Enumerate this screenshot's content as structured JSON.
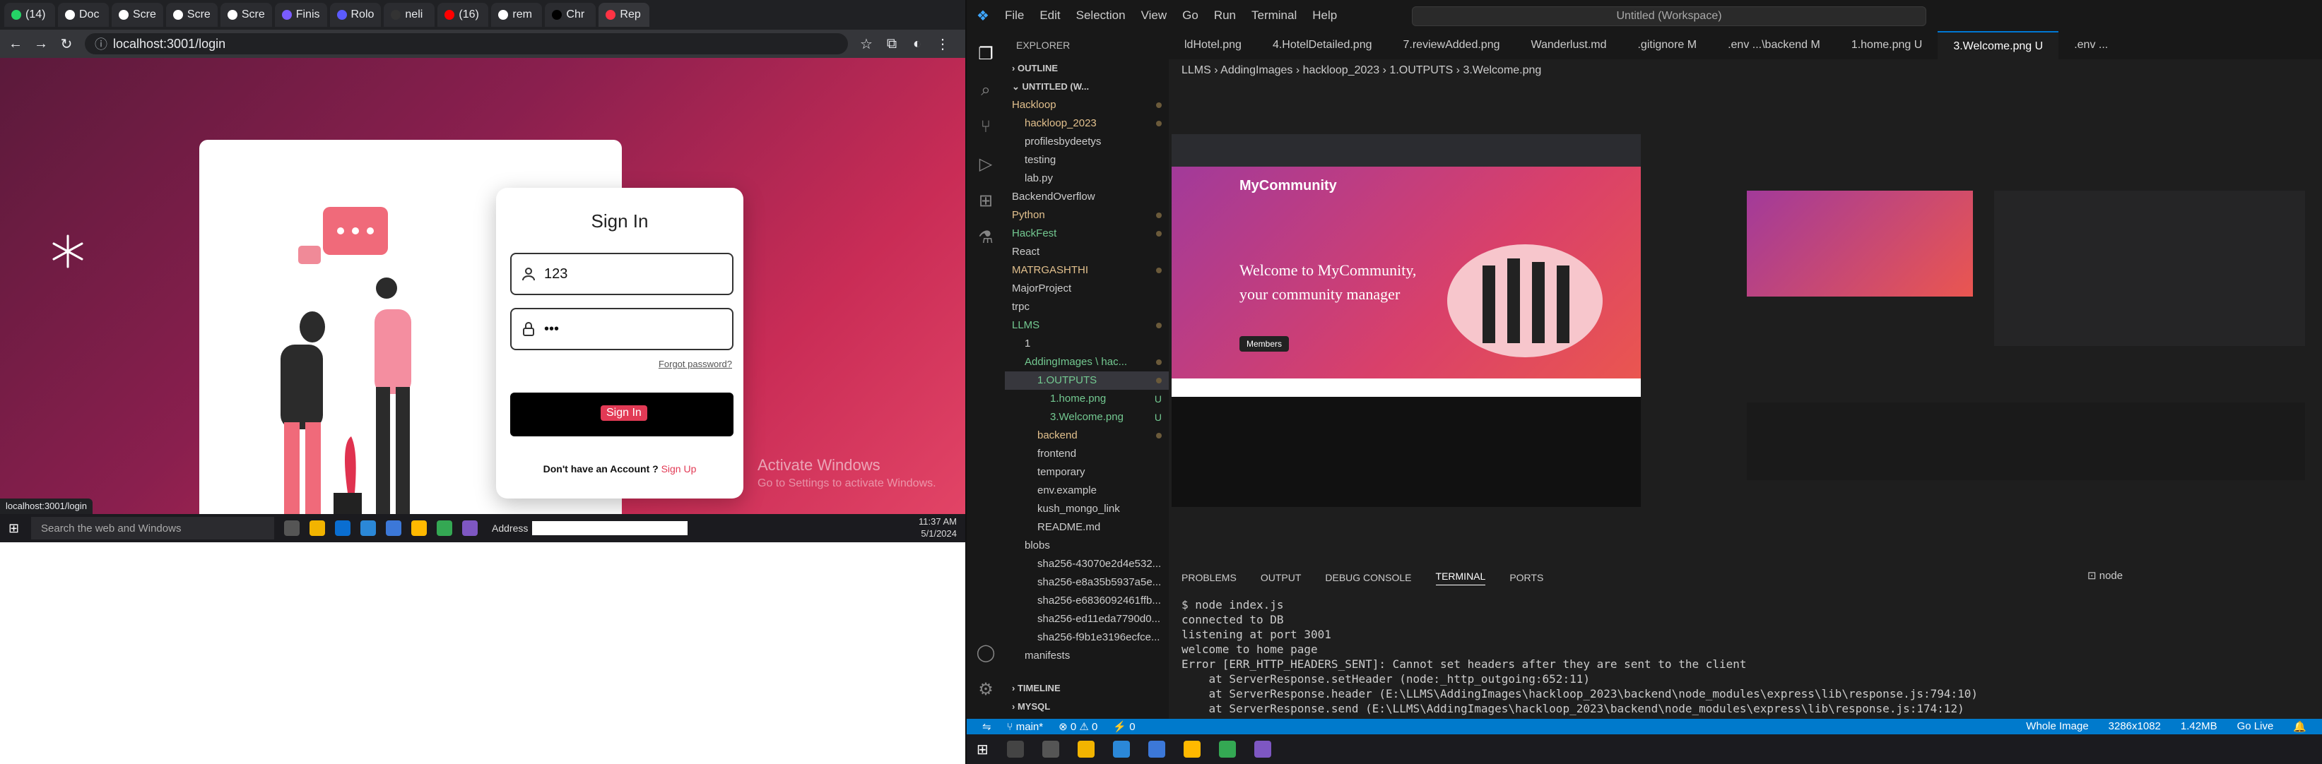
{
  "browser": {
    "tabs": [
      {
        "label": "(14)",
        "color": "#25d366"
      },
      {
        "label": "Doc",
        "color": "#ffffff"
      },
      {
        "label": "Scre",
        "color": "#ffffff"
      },
      {
        "label": "Scre",
        "color": "#ffffff"
      },
      {
        "label": "Scre",
        "color": "#ffffff"
      },
      {
        "label": "Finis",
        "color": "#7a5cff"
      },
      {
        "label": "Rolo",
        "color": "#5b5bff"
      },
      {
        "label": "neli",
        "color": "#333333"
      },
      {
        "label": "(16)",
        "color": "#ff0000"
      },
      {
        "label": "rem",
        "color": "#ffffff"
      },
      {
        "label": "Chr",
        "color": "#000000"
      },
      {
        "label": "Rep",
        "color": "#ff3344"
      }
    ],
    "url": "localhost:3001/login",
    "status_url": "localhost:3001/login",
    "signin": {
      "title": "Sign In",
      "username_value": "123",
      "password_value": "•••",
      "forgot": "Forgot password?",
      "button": "Sign In",
      "no_account": "Don't have an Account ?",
      "signup": "Sign Up"
    },
    "activate": {
      "title": "Activate Windows",
      "sub": "Go to Settings to activate Windows."
    },
    "taskbar": {
      "search": "Search the web and Windows",
      "address_label": "Address",
      "time": "11:37 AM",
      "date": "5/1/2024"
    }
  },
  "vscode": {
    "menu": [
      "File",
      "Edit",
      "Selection",
      "View",
      "Go",
      "Run",
      "Terminal",
      "Help"
    ],
    "search": "Untitled (Workspace)",
    "explorer_title": "EXPLORER",
    "outline": "OUTLINE",
    "workspace": "UNTITLED (W...",
    "tree": [
      {
        "label": "Hackloop",
        "indent": 0,
        "color": "#e2c08d",
        "mod": true
      },
      {
        "label": "hackloop_2023",
        "indent": 1,
        "color": "#e2c08d",
        "mod": true
      },
      {
        "label": "profilesbydeetys",
        "indent": 1,
        "color": "#cccccc",
        "mod": false
      },
      {
        "label": "testing",
        "indent": 1,
        "color": "#cccccc",
        "mod": false
      },
      {
        "label": "lab.py",
        "indent": 1,
        "color": "#cccccc",
        "mod": false
      },
      {
        "label": "BackendOverflow",
        "indent": 0,
        "color": "#cccccc",
        "mod": false
      },
      {
        "label": "Python",
        "indent": 0,
        "color": "#e2c08d",
        "mod": true
      },
      {
        "label": "HackFest",
        "indent": 0,
        "color": "#73c991",
        "mod": true
      },
      {
        "label": "React",
        "indent": 0,
        "color": "#cccccc",
        "mod": false
      },
      {
        "label": "MATRGASHTHI",
        "indent": 0,
        "color": "#e2c08d",
        "mod": true
      },
      {
        "label": "MajorProject",
        "indent": 0,
        "color": "#cccccc",
        "mod": false
      },
      {
        "label": "trpc",
        "indent": 0,
        "color": "#cccccc",
        "mod": false
      },
      {
        "label": "LLMS",
        "indent": 0,
        "color": "#73c991",
        "mod": true
      },
      {
        "label": "1",
        "indent": 1,
        "color": "#cccccc",
        "mod": false
      },
      {
        "label": "AddingImages \\ hac...",
        "indent": 1,
        "color": "#73c991",
        "mod": true
      },
      {
        "label": "1.OUTPUTS",
        "indent": 2,
        "color": "#73c991",
        "mod": true,
        "sel": true
      },
      {
        "label": "1.home.png",
        "indent": 3,
        "color": "#73c991",
        "badge": "U"
      },
      {
        "label": "3.Welcome.png",
        "indent": 3,
        "color": "#73c991",
        "badge": "U"
      },
      {
        "label": "backend",
        "indent": 2,
        "color": "#e2c08d",
        "mod": true
      },
      {
        "label": "frontend",
        "indent": 2,
        "color": "#cccccc",
        "mod": false
      },
      {
        "label": "temporary",
        "indent": 2,
        "color": "#cccccc",
        "mod": false
      },
      {
        "label": "env.example",
        "indent": 2,
        "color": "#cccccc",
        "mod": false
      },
      {
        "label": "kush_mongo_link",
        "indent": 2,
        "color": "#cccccc",
        "mod": false
      },
      {
        "label": "README.md",
        "indent": 2,
        "color": "#cccccc",
        "mod": false
      },
      {
        "label": "blobs",
        "indent": 1,
        "color": "#cccccc",
        "mod": false
      },
      {
        "label": "sha256-43070e2d4e532...",
        "indent": 2,
        "color": "#cccccc",
        "mod": false
      },
      {
        "label": "sha256-e8a35b5937a5e...",
        "indent": 2,
        "color": "#cccccc",
        "mod": false
      },
      {
        "label": "sha256-e6836092461ffb...",
        "indent": 2,
        "color": "#cccccc",
        "mod": false
      },
      {
        "label": "sha256-ed11eda7790d0...",
        "indent": 2,
        "color": "#cccccc",
        "mod": false
      },
      {
        "label": "sha256-f9b1e3196ecfce...",
        "indent": 2,
        "color": "#cccccc",
        "mod": false
      },
      {
        "label": "manifests",
        "indent": 1,
        "color": "#cccccc",
        "mod": false
      }
    ],
    "timeline": "TIMELINE",
    "mysql": "MYSQL",
    "editor_tabs": [
      "ldHotel.png",
      "4.HotelDetailed.png",
      "7.reviewAdded.png",
      "Wanderlust.md",
      ".gitignore M",
      ".env ...\\backend M",
      "1.home.png U",
      "3.Welcome.png U",
      ".env ..."
    ],
    "active_tab": 7,
    "breadcrumbs": [
      "LLMS",
      "AddingImages",
      "hackloop_2023",
      "1.OUTPUTS",
      "3.Welcome.png"
    ],
    "preview_texts": {
      "brand": "MyCommunity",
      "welcome": "Welcome to MyCommunity, your community manager",
      "cta": "Members"
    },
    "panel_tabs": [
      "PROBLEMS",
      "OUTPUT",
      "DEBUG CONSOLE",
      "TERMINAL",
      "PORTS"
    ],
    "active_panel": 3,
    "terminal_name": "node",
    "terminal_lines": [
      "$ node index.js",
      "connected to DB",
      "listening at port 3001",
      "welcome to home page",
      "Error [ERR_HTTP_HEADERS_SENT]: Cannot set headers after they are sent to the client",
      "    at ServerResponse.setHeader (node:_http_outgoing:652:11)",
      "    at ServerResponse.header (E:\\LLMS\\AddingImages\\hackloop_2023\\backend\\node_modules\\express\\lib\\response.js:794:10)",
      "    at ServerResponse.send (E:\\LLMS\\AddingImages\\hackloop_2023\\backend\\node_modules\\express\\lib\\response.js:174:12)"
    ],
    "status": {
      "branch": "main*",
      "errors": "0",
      "warnings": "0",
      "ports": "0",
      "image": "Whole Image",
      "dims": "3286x1082",
      "size": "1.42MB",
      "live": "Go Live"
    }
  }
}
